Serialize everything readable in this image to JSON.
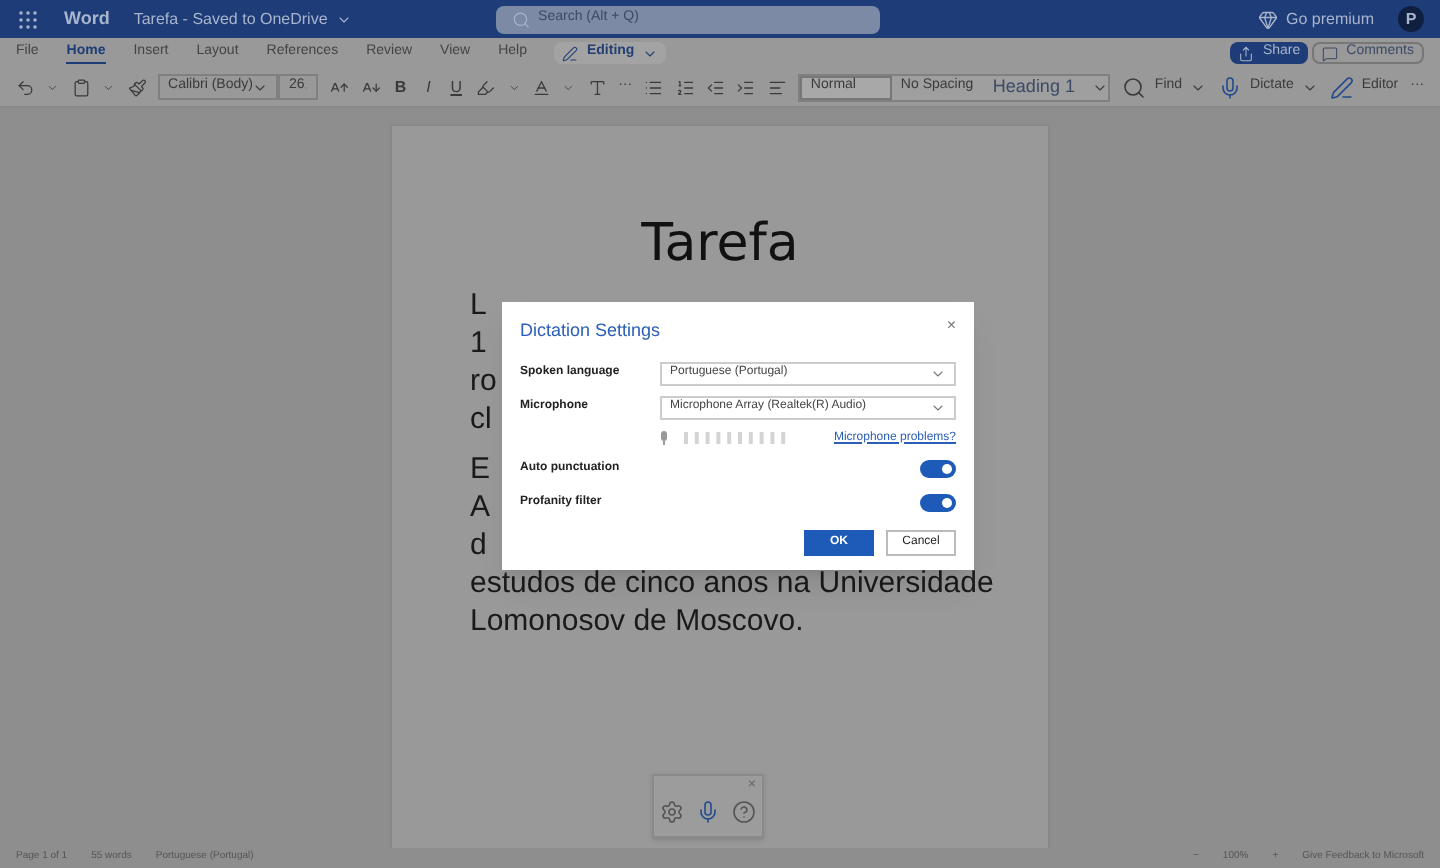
{
  "title_bar": {
    "app": "Word",
    "document": "Tarefa - Saved to OneDrive",
    "search_placeholder": "Search (Alt + Q)",
    "premium": "Go premium",
    "avatar": "P"
  },
  "tabs": [
    {
      "label": "File",
      "selected": false
    },
    {
      "label": "Home",
      "selected": true
    },
    {
      "label": "Insert",
      "selected": false
    },
    {
      "label": "Layout",
      "selected": false
    },
    {
      "label": "References",
      "selected": false
    },
    {
      "label": "Review",
      "selected": false
    },
    {
      "label": "View",
      "selected": false
    },
    {
      "label": "Help",
      "selected": false
    }
  ],
  "mode": "Editing",
  "share": "Share",
  "comments": "Comments",
  "toolbar": {
    "font": "Calibri (Body)",
    "size": "26",
    "format_buttons": [
      "B",
      "I",
      "U"
    ],
    "more": "···",
    "styles": [
      {
        "label": "Normal",
        "kind": "normal",
        "selected": true
      },
      {
        "label": "No Spacing",
        "kind": "normal",
        "selected": false
      },
      {
        "label": "Heading 1",
        "kind": "heading",
        "selected": false
      }
    ],
    "find": "Find",
    "dictate": "Dictate",
    "editor": "Editor",
    "more_end": "···"
  },
  "document": {
    "title": "Tarefa",
    "paragraphs": [
      {
        "lines": [
          "L",
          "1",
          "ro",
          "cl"
        ]
      },
      {
        "lines": [
          "E",
          "A",
          "d",
          "estudos de cinco anos na Universidade",
          "Lomonosov de Moscovo."
        ]
      }
    ]
  },
  "dialog": {
    "title": "Dictation Settings",
    "close": "×",
    "fields": [
      {
        "label": "Spoken language",
        "value": "Portuguese (Portugal)"
      },
      {
        "label": "Microphone",
        "value": "Microphone Array (Realtek(R) Audio)"
      }
    ],
    "link": "Microphone problems?",
    "toggles": [
      {
        "label": "Auto punctuation",
        "on": true
      },
      {
        "label": "Profanity filter",
        "on": true
      }
    ],
    "ok": "OK",
    "cancel": "Cancel"
  },
  "dictation_toolbar": {
    "close": "×"
  },
  "status_bar": {
    "page": "Page 1 of 1",
    "words": "55 words",
    "language": "Portuguese (Portugal)",
    "zoom_out": "−",
    "zoom": "100%",
    "zoom_in": "+",
    "feedback": "Give Feedback to Microsoft"
  }
}
